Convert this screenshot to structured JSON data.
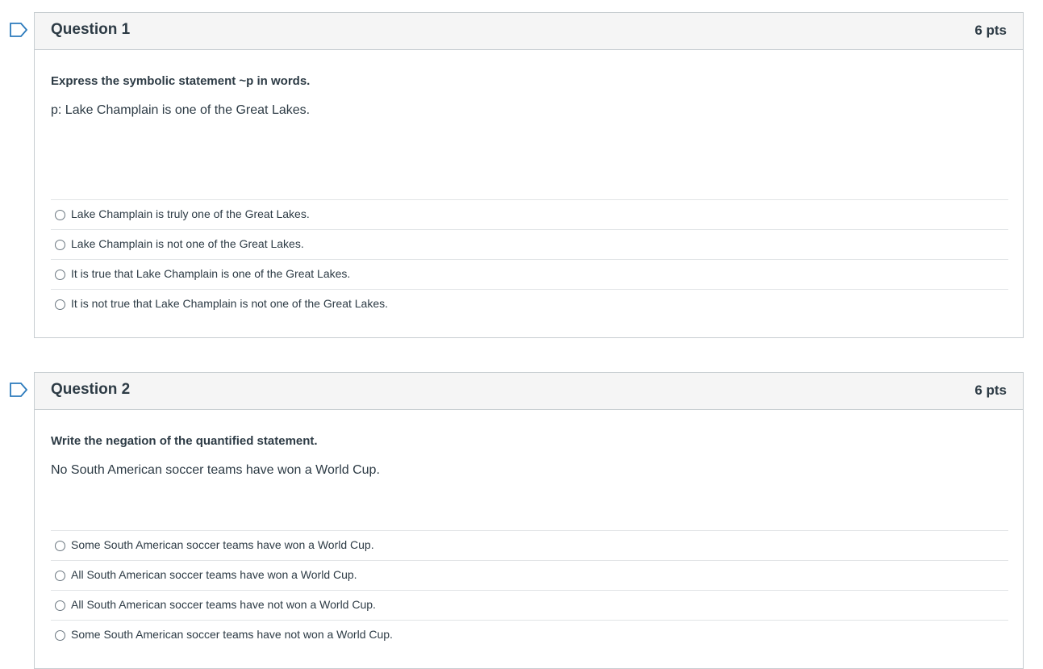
{
  "questions": [
    {
      "title": "Question 1",
      "points": "6 pts",
      "prompt": "Express the symbolic statement ~p in words.",
      "statement": "p: Lake Champlain is one of the Great Lakes.",
      "answers": [
        "Lake Champlain is truly one of the Great Lakes.",
        "Lake Champlain is not one of the Great Lakes.",
        "It is true that Lake Champlain is one of the Great Lakes.",
        "It is not true that Lake Champlain is not one of the Great Lakes."
      ]
    },
    {
      "title": "Question 2",
      "points": "6 pts",
      "prompt": "Write the negation of the quantified statement.",
      "statement": "No South American soccer teams have won a World Cup.",
      "answers": [
        "Some South American soccer teams have won a World Cup.",
        "All South American soccer teams have won a World Cup.",
        "All South American soccer teams have not won a World Cup.",
        "Some South American soccer teams have not won a World Cup."
      ]
    }
  ],
  "colors": {
    "header_bg": "#f5f5f5",
    "border": "#c7cdd1",
    "text": "#2d3b45",
    "flag": "#2b7abc"
  },
  "icons": {
    "flag": "flag-question-icon",
    "radio": "radio-circle"
  }
}
